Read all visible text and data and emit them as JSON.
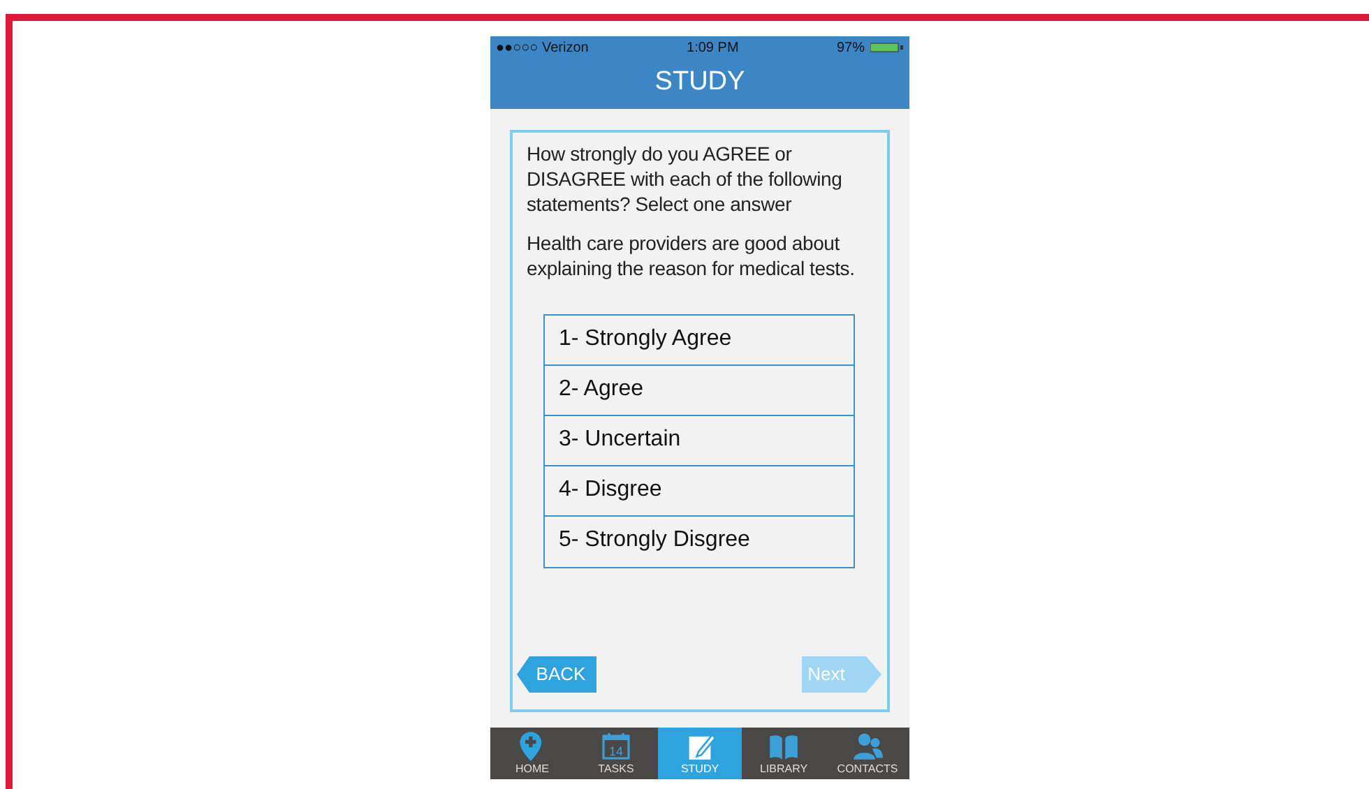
{
  "status_bar": {
    "carrier": "●●○○○ Verizon",
    "time": "1:09 PM",
    "battery": "97%"
  },
  "title": "STUDY",
  "question": {
    "prompt": "How strongly do you AGREE or DISAGREE with each of the following statements? Select one answer",
    "statement": "Health care providers are good about explaining the reason for medical tests."
  },
  "answers": [
    {
      "label": "1- Strongly Agree",
      "selected": false
    },
    {
      "label": "2- Agree",
      "selected": false
    },
    {
      "label": "3- Uncertain",
      "selected": false
    },
    {
      "label": "4- Disgree",
      "selected": false
    },
    {
      "label": "5- Strongly Disgree",
      "selected": false
    }
  ],
  "back_button": {
    "label": "BACK",
    "disabled": false
  },
  "next_button": {
    "label": "Next",
    "disabled": true
  },
  "tab_bar": [
    {
      "label": "HOME",
      "kind": "pin",
      "selected": false
    },
    {
      "label": "TASKS",
      "kind": "calendar",
      "day": "14",
      "selected": false
    },
    {
      "label": "STUDY",
      "kind": "edit",
      "selected": true
    },
    {
      "label": "LIBRARY",
      "kind": "book",
      "selected": false
    },
    {
      "label": "CONTACTS",
      "kind": "people",
      "selected": false
    }
  ]
}
